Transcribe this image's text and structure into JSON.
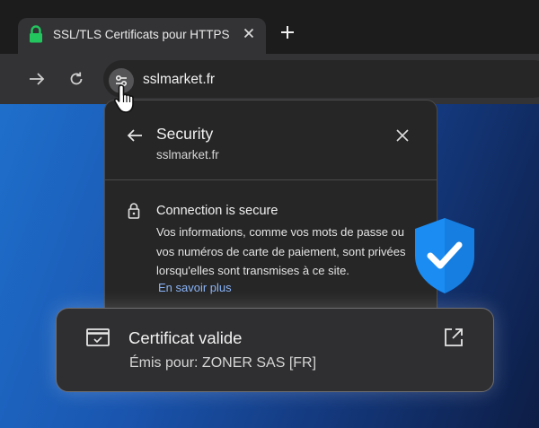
{
  "tab": {
    "title": "SSL/TLS Certificats pour HTTPS"
  },
  "address_bar": {
    "url": "sslmarket.fr"
  },
  "security_popup": {
    "title": "Security",
    "site": "sslmarket.fr",
    "connection_title": "Connection is secure",
    "connection_description": "Vos informations, comme vos mots de passe ou vos numéros de carte de paiement, sont privées lorsqu'elles sont transmises à ce site.",
    "learn_more": "En savoir plus"
  },
  "certificate_card": {
    "title": "Certificat valide",
    "issued_to": "Émis pour: ZONER SAS [FR]"
  },
  "colors": {
    "secure_lock": "#22c55e",
    "shield": "#1b8cf2",
    "link": "#8ab4f8"
  }
}
